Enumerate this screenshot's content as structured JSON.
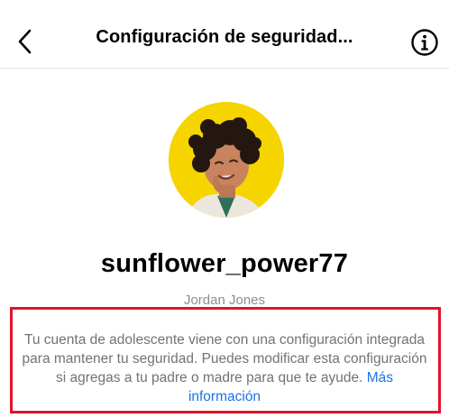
{
  "header": {
    "back_icon": "chevron-left-icon",
    "title": "Configuración de seguridad...",
    "info_icon": "info-circle-icon"
  },
  "profile": {
    "avatar_background": "#f5d400",
    "username": "sunflower_power77",
    "full_name": "Jordan Jones"
  },
  "notice": {
    "text": "Tu cuenta de adolescente viene con una configuración integrada para mantener tu seguridad. Puedes modificar esta configuración si agregas a tu padre o madre para que te ayude. ",
    "link_label": "Más información"
  },
  "colors": {
    "highlight_border": "#e0142c",
    "link": "#1b74e4",
    "secondary_text": "#737373"
  }
}
